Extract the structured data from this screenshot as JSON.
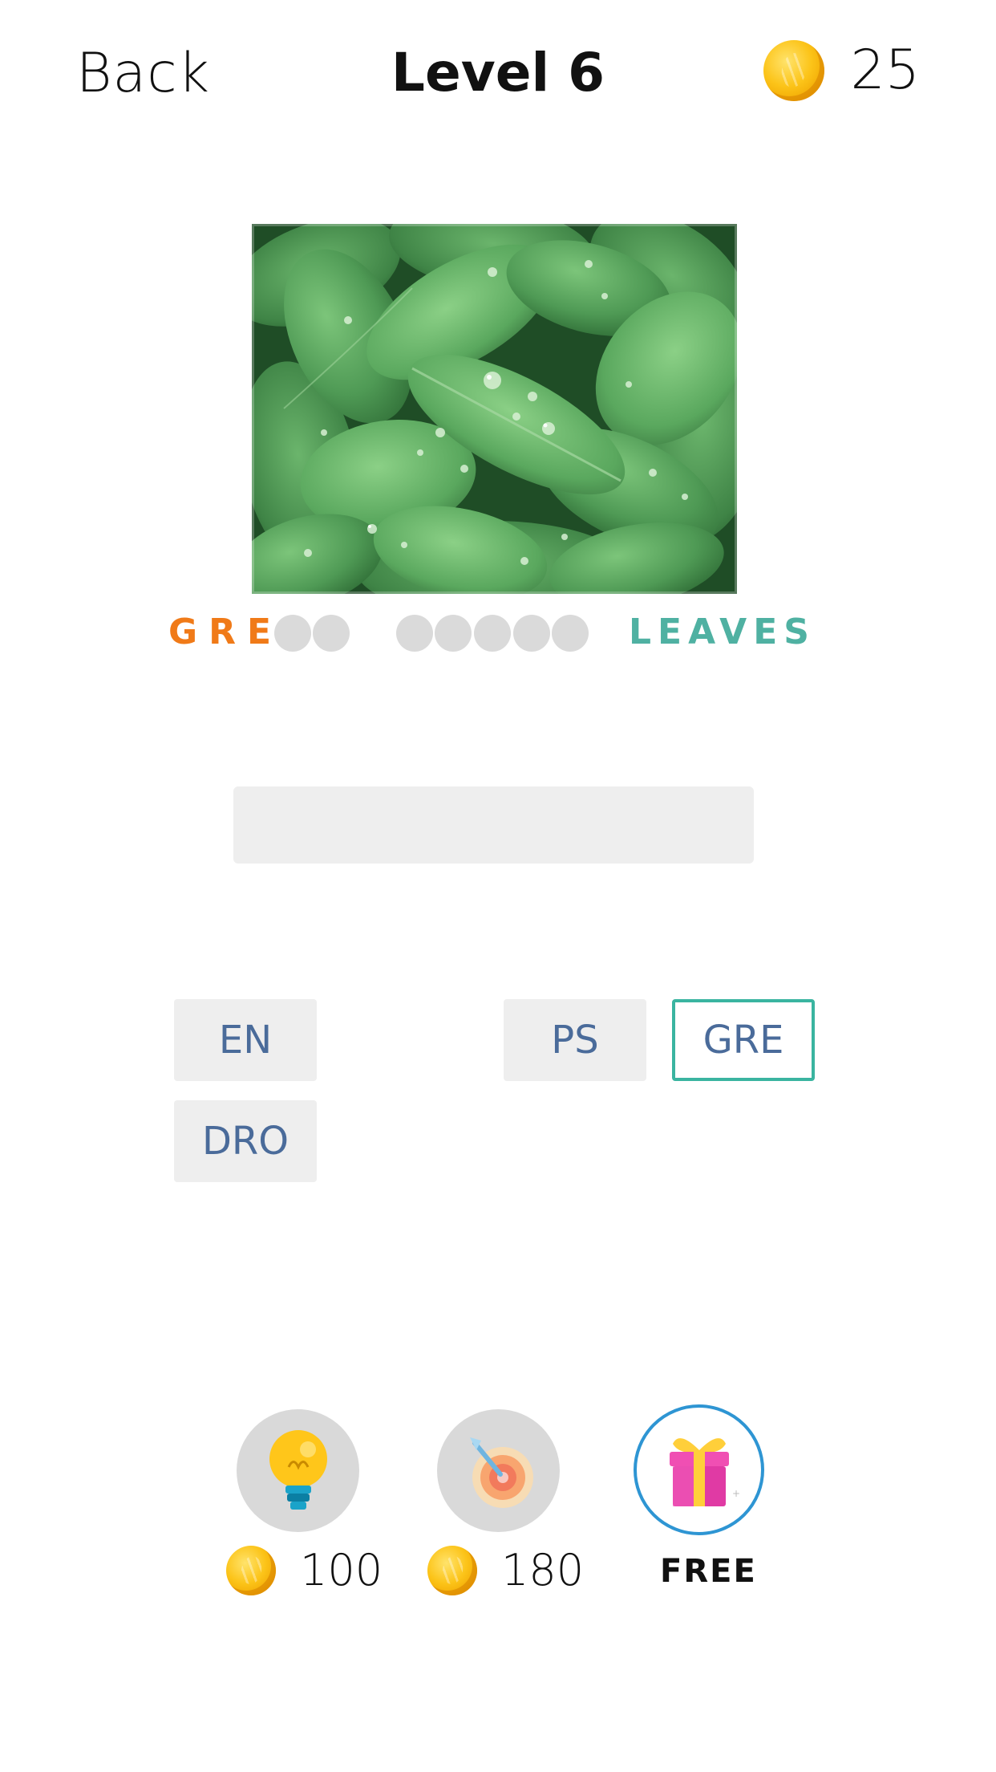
{
  "header": {
    "back_label": "Back",
    "level_title": "Level 6",
    "coins": "25"
  },
  "puzzle": {
    "image_subject": "green leaves with water drops",
    "clue_letters": "GRE",
    "hidden_letter_slots_word1": 2,
    "hidden_letter_slots_word2": 5,
    "solved_word": "LEAVES"
  },
  "answer_input": {
    "value": ""
  },
  "tiles": [
    {
      "label": "EN",
      "selected": false
    },
    {
      "label": "PS",
      "selected": false
    },
    {
      "label": "GRE",
      "selected": true
    },
    {
      "label": "DRO",
      "selected": false
    }
  ],
  "helpers": {
    "hint": {
      "icon": "lightbulb-icon",
      "cost": "100"
    },
    "reveal": {
      "icon": "target-icon",
      "cost": "180"
    },
    "gift": {
      "icon": "gift-icon",
      "label": "FREE"
    }
  },
  "colors": {
    "clue_orange": "#f07a18",
    "solved_teal": "#4fb1a2",
    "tile_text": "#4a6b9a",
    "tile_selected_border": "#3ab4a0",
    "gift_ring": "#2e95d3",
    "coin_gold": "#fcc419"
  }
}
